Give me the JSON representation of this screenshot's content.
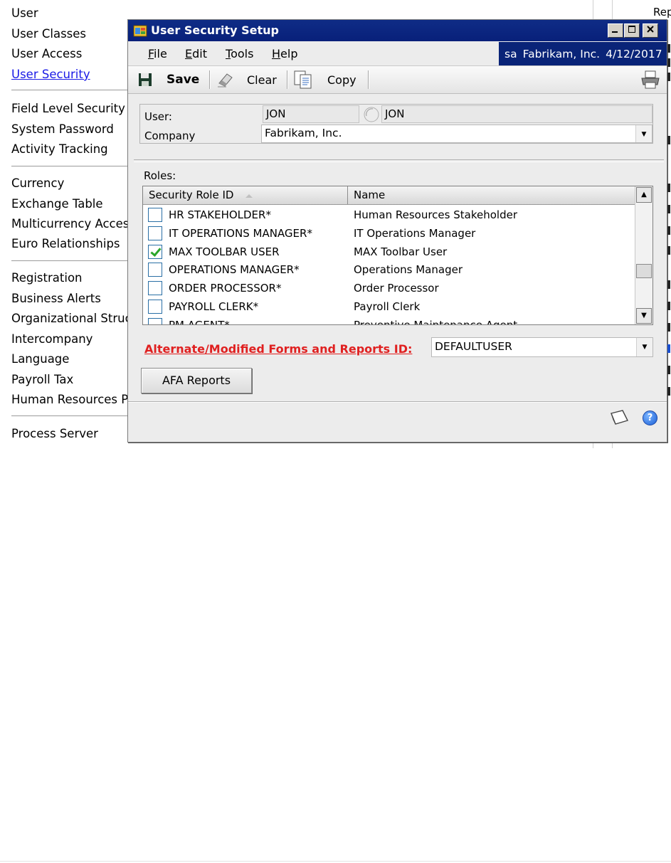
{
  "nav": {
    "items": [
      {
        "label": "User",
        "link": false
      },
      {
        "label": "User Classes",
        "link": false
      },
      {
        "label": "User Access",
        "link": false
      },
      {
        "label": "User Security",
        "link": true
      },
      {
        "label": "Field Level Security",
        "link": false
      },
      {
        "label": "System Password",
        "link": false
      },
      {
        "label": "Activity Tracking",
        "link": false
      },
      {
        "label": "Currency",
        "link": false
      },
      {
        "label": "Exchange Table",
        "link": false
      },
      {
        "label": "Multicurrency Acces",
        "link": false
      },
      {
        "label": "Euro Relationships",
        "link": false
      },
      {
        "label": "Registration",
        "link": false
      },
      {
        "label": "Business Alerts",
        "link": false
      },
      {
        "label": "Organizational Struc",
        "link": false
      },
      {
        "label": "Intercompany",
        "link": false
      },
      {
        "label": "Language",
        "link": false
      },
      {
        "label": "Payroll Tax",
        "link": false
      },
      {
        "label": "Human Resources Pr",
        "link": false
      },
      {
        "label": "Process Server",
        "link": false
      }
    ]
  },
  "background": {
    "right_text": "Rep"
  },
  "window": {
    "title": "User Security Setup",
    "caption_buttons": [
      "minimize-icon",
      "maximize-icon",
      "close-icon"
    ],
    "menu": [
      {
        "label": "File",
        "accel": "F",
        "rest": "ile"
      },
      {
        "label": "Edit",
        "accel": "E",
        "rest": "dit"
      },
      {
        "label": "Tools",
        "accel": "T",
        "rest": "ools"
      },
      {
        "label": "Help",
        "accel": "H",
        "rest": "elp"
      }
    ],
    "status": {
      "user": "sa",
      "company": "Fabrikam, Inc.",
      "date": "4/12/2017"
    },
    "toolbar": {
      "save_label": "Save",
      "clear_label": "Clear",
      "copy_label": "Copy"
    },
    "form": {
      "user_label": "User:",
      "user_id": "JON",
      "user_name": "JON",
      "company_label": "Company",
      "company_value": "Fabrikam, Inc."
    },
    "roles": {
      "label": "Roles:",
      "columns": [
        "Security Role ID",
        "Name"
      ],
      "rows": [
        {
          "id": "HR STAKEHOLDER*",
          "name": "Human Resources Stakeholder",
          "checked": false
        },
        {
          "id": "IT OPERATIONS MANAGER*",
          "name": "IT Operations Manager",
          "checked": false
        },
        {
          "id": "MAX TOOLBAR USER",
          "name": "MAX Toolbar User",
          "checked": true
        },
        {
          "id": "OPERATIONS MANAGER*",
          "name": "Operations Manager",
          "checked": false
        },
        {
          "id": "ORDER PROCESSOR*",
          "name": "Order Processor",
          "checked": false
        },
        {
          "id": "PAYROLL CLERK*",
          "name": "Payroll Clerk",
          "checked": false
        },
        {
          "id": "PM AGENT*",
          "name": "Preventive Maintenance Agent",
          "checked": false
        }
      ]
    },
    "alternate": {
      "label": "Alternate/Modified Forms and Reports ID:",
      "value": "DEFAULTUSER"
    },
    "afa_button": "AFA Reports",
    "colors": {
      "title_bar": "#0f2c86",
      "alt_label": "#e02020",
      "link": "#1a1ae6"
    }
  }
}
